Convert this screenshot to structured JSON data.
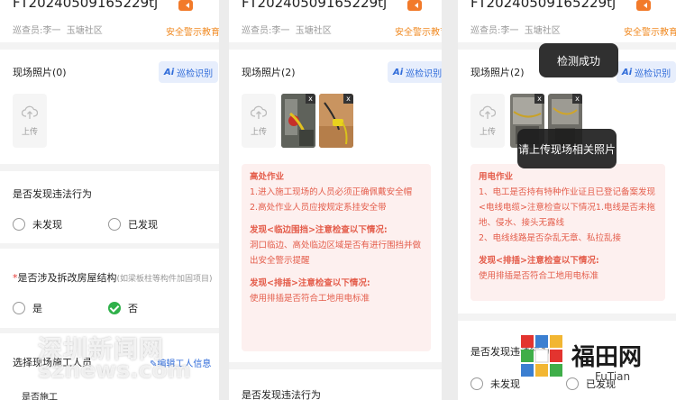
{
  "header": {
    "code": "FT20240509165229tj",
    "inspector": "巡查员:李一",
    "community": "玉塘社区",
    "safety_edu": "安全警示教育"
  },
  "photo": {
    "title_empty": "现场照片(0)",
    "title_filled": "现场照片(2)",
    "ai_mark": "Ai",
    "ai_label": "巡检识别",
    "upload_label": "上传",
    "delete_mark": "x"
  },
  "panel1": {
    "violation_q": "是否发现违法行为",
    "opt_not_found": "未发现",
    "opt_found": "已发现",
    "structure_req": "*",
    "structure_q": "是否涉及拆改房屋结构",
    "structure_hint": "(如梁板柱等构件加固项目)",
    "opt_yes": "是",
    "opt_no": "否",
    "worker_q": "选择现场施工人员",
    "edit_worker": "编辑工人信息",
    "partial_row": "是否施工"
  },
  "panel2": {
    "alert": {
      "heading": "高处作业",
      "line1": "1.进入施工现场的人员必须正确佩戴安全帽",
      "line2": "2.高处作业人员应按规定系挂安全带",
      "heading2": "发现<临边围挡>注意检查以下情况:",
      "line3": "洞口临边、高处临边区域是否有进行围挡并做出安全警示提醒",
      "heading3": "发现<排插>注意检查以下情况:",
      "line4": "使用排插是否符合工地用电标准"
    },
    "violation_q": "是否发现违法行为"
  },
  "panel3": {
    "alert": {
      "heading": "用电作业",
      "line1": "1、电工是否持有特种作业证且已登记备案发现<电线电缆>注意检查以下情况1.电线是否未拖地、侵水、接头无露线",
      "line2": "2、电线线路是否杂乱无章、私拉乱接",
      "heading2": "发现<排插>注意检查以下情况:",
      "line3": "使用排插是否符合工地用电标准"
    },
    "violation_q": "是否发现违法行为",
    "opt_not_found": "未发现",
    "opt_found": "已发现",
    "toast_success": "检测成功",
    "toast_upload": "请上传现场相关照片"
  },
  "watermark": {
    "cn": "深圳新闻网",
    "en": "sznews.com",
    "logo_cn": "福田网",
    "logo_en": "FuTian"
  },
  "colors": {
    "accent_blue": "#2f6bd9",
    "warning_orange": "#f08a22",
    "alert_red": "#e45d4b",
    "check_green": "#2fb14a"
  }
}
